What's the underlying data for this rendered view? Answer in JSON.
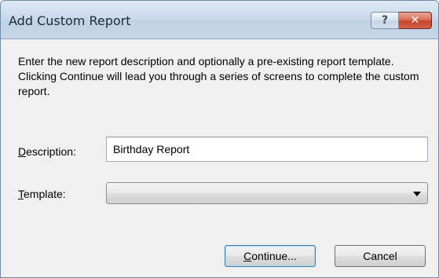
{
  "window": {
    "title": "Add Custom Report",
    "help_label": "?",
    "close_label": "✕"
  },
  "intro_text": "Enter the new report description and optionally a pre-existing report template. Clicking Continue will lead you through a series of screens to complete the custom report.",
  "description": {
    "label_mnemonic": "D",
    "label_rest": "escription:",
    "value": "Birthday Report"
  },
  "template": {
    "label_mnemonic": "T",
    "label_rest": "emplate:",
    "selected": ""
  },
  "buttons": {
    "continue_mnemonic": "C",
    "continue_rest": "ontinue...",
    "cancel_label": "Cancel"
  }
}
